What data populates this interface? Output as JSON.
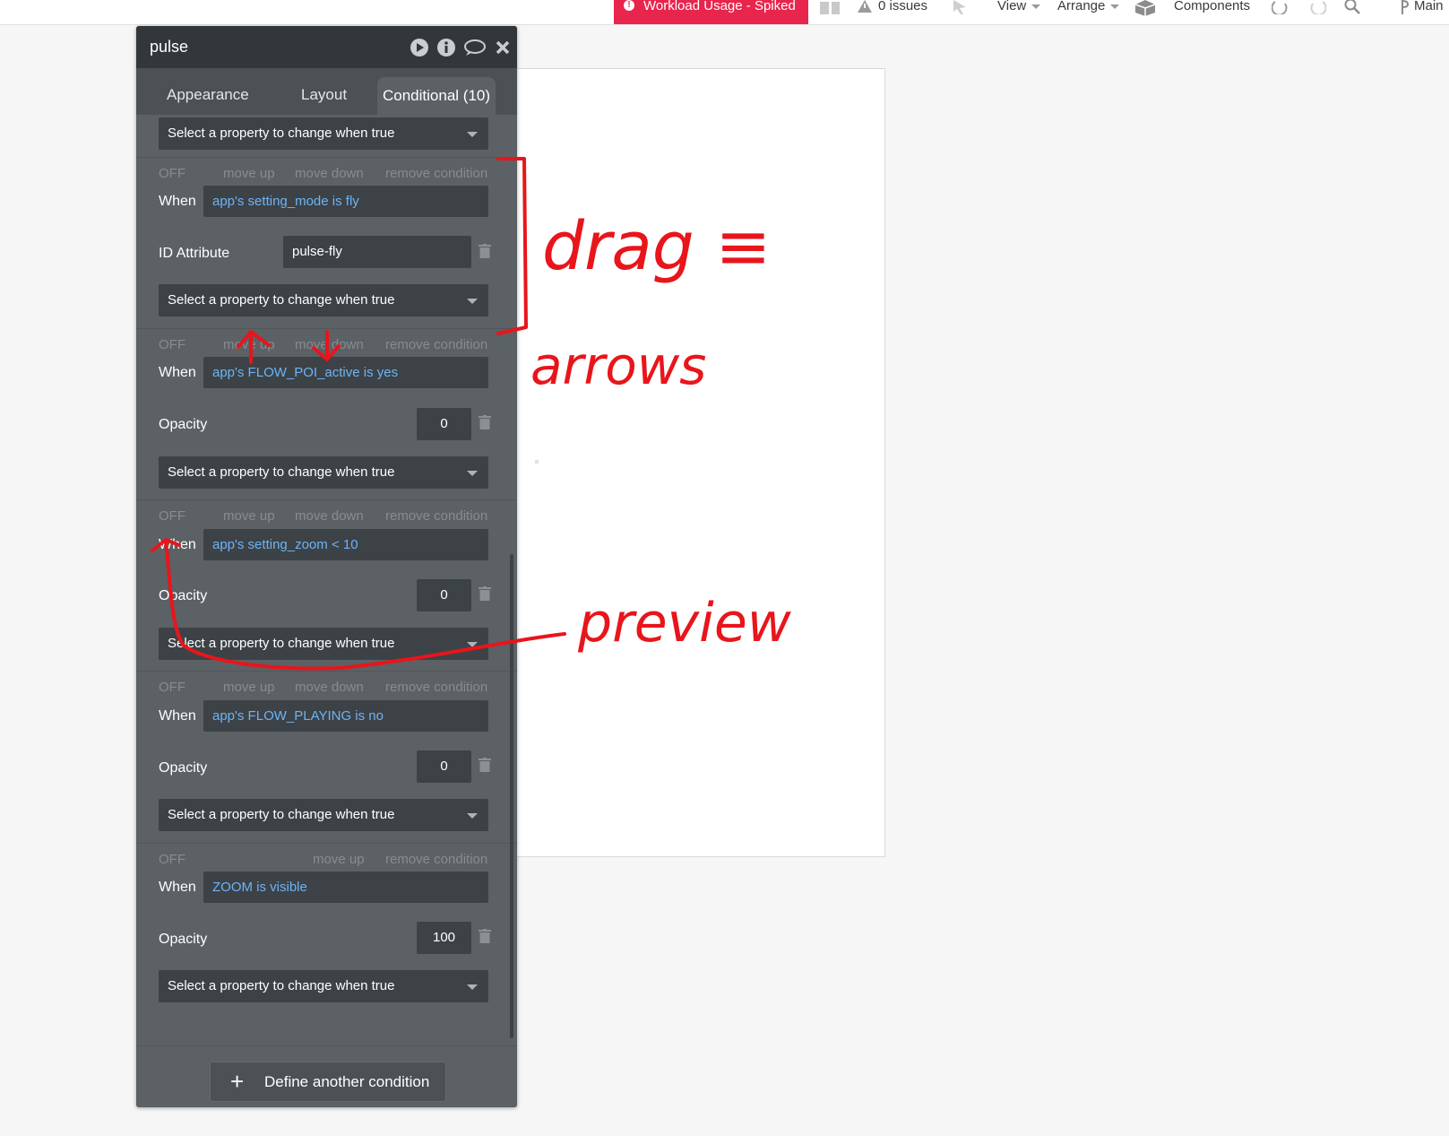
{
  "topbar": {
    "alert_label": "Workload Usage - Spiked",
    "issues_label": "0 issues",
    "view_label": "View",
    "arrange_label": "Arrange",
    "components_label": "Components",
    "branch_label": "Main"
  },
  "panel": {
    "title": "pulse",
    "tabs": [
      "Appearance",
      "Layout",
      "Conditional (10)"
    ],
    "select_placeholder": "Select a property to change when true",
    "off_label": "OFF",
    "move_up_label": "move up",
    "move_down_label": "move down",
    "remove_label": "remove condition",
    "when_label": "When",
    "conditions": [
      {
        "when": "app's setting_mode is fly",
        "property": "ID Attribute",
        "value": "pulse-fly"
      },
      {
        "when": "app's FLOW_POI_active is yes",
        "property": "Opacity",
        "value": "0"
      },
      {
        "when": "app's setting_zoom < 10",
        "property": "Opacity",
        "value": "0"
      },
      {
        "when": "app's FLOW_PLAYING is no",
        "property": "Opacity",
        "value": "0"
      },
      {
        "when": "ZOOM is visible",
        "property": "Opacity",
        "value": "100"
      }
    ],
    "define_button": "Define another condition"
  },
  "annotations": {
    "drag": "drag ≡",
    "arrows": "arrows",
    "preview": "preview"
  },
  "colors": {
    "alert_bg": "#e8254d",
    "panel_bg": "#5b6165",
    "panel_header": "#31373a",
    "condition_text": "#6db3f6",
    "annotation": "#e8151b"
  }
}
